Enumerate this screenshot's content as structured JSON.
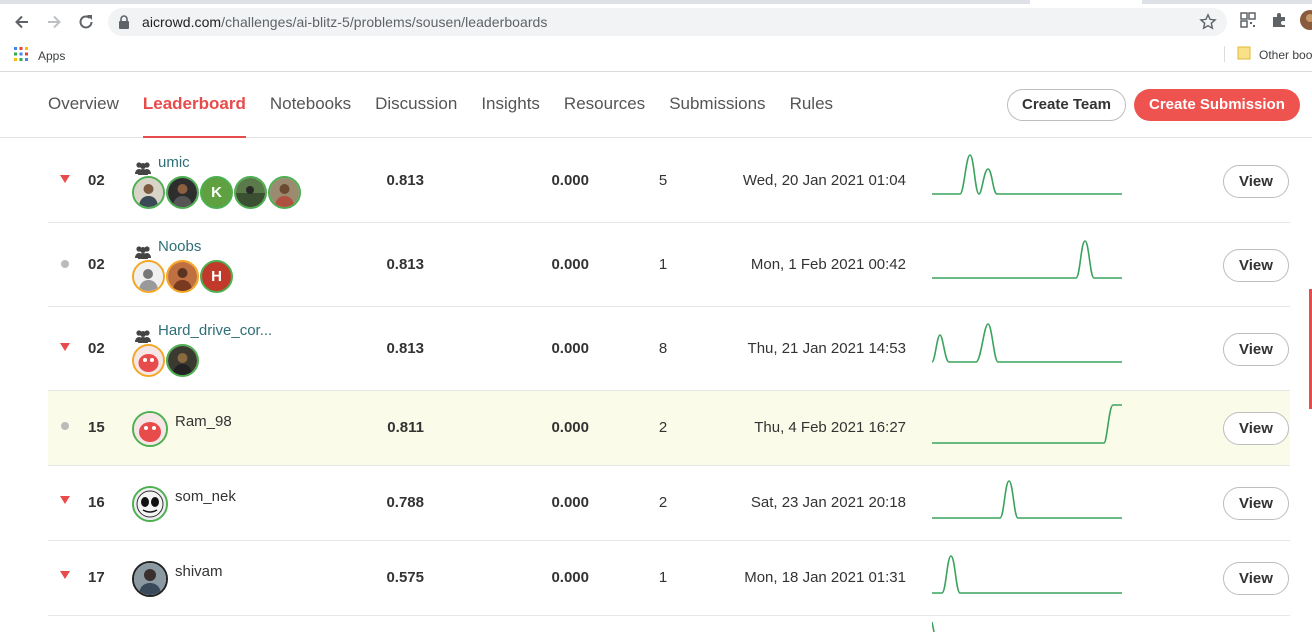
{
  "browser": {
    "url_domain": "aicrowd.com",
    "url_path": "/challenges/ai-blitz-5/problems/sousen/leaderboards",
    "bookmarks_apps": "Apps",
    "bookmarks_other": "Other boo"
  },
  "nav": {
    "tabs": [
      {
        "label": "Overview",
        "active": false
      },
      {
        "label": "Leaderboard",
        "active": true
      },
      {
        "label": "Notebooks",
        "active": false
      },
      {
        "label": "Discussion",
        "active": false
      },
      {
        "label": "Insights",
        "active": false
      },
      {
        "label": "Resources",
        "active": false
      },
      {
        "label": "Submissions",
        "active": false
      },
      {
        "label": "Rules",
        "active": false
      }
    ],
    "create_team": "Create Team",
    "create_submission": "Create Submission"
  },
  "colors": {
    "accent": "#e84b4b",
    "spark": "#3aa35d",
    "highlight_row": "#fbfbe9"
  },
  "rows": [
    {
      "trend": "down",
      "rank": "02",
      "is_team": true,
      "name": "umic",
      "score_primary": "0.813",
      "score_secondary": "0.000",
      "submissions": "5",
      "date": "Wed, 20 Jan 2021 01:04",
      "action": "View",
      "avatar_count": 5
    },
    {
      "trend": "same",
      "rank": "02",
      "is_team": true,
      "name": "Noobs",
      "score_primary": "0.813",
      "score_secondary": "0.000",
      "submissions": "1",
      "date": "Mon, 1 Feb 2021 00:42",
      "action": "View",
      "avatar_count": 3
    },
    {
      "trend": "down",
      "rank": "02",
      "is_team": true,
      "name": "Hard_drive_cor...",
      "score_primary": "0.813",
      "score_secondary": "0.000",
      "submissions": "8",
      "date": "Thu, 21 Jan 2021 14:53",
      "action": "View",
      "avatar_count": 2
    },
    {
      "trend": "same",
      "rank": "15",
      "is_team": false,
      "name": "Ram_98",
      "score_primary": "0.811",
      "score_secondary": "0.000",
      "submissions": "2",
      "date": "Thu, 4 Feb 2021 16:27",
      "action": "View",
      "highlight": true
    },
    {
      "trend": "down",
      "rank": "16",
      "is_team": false,
      "name": "som_nek",
      "score_primary": "0.788",
      "score_secondary": "0.000",
      "submissions": "2",
      "date": "Sat, 23 Jan 2021 20:18",
      "action": "View"
    },
    {
      "trend": "down",
      "rank": "17",
      "is_team": false,
      "name": "shivam",
      "score_primary": "0.575",
      "score_secondary": "0.000",
      "submissions": "1",
      "date": "Mon, 18 Jan 2021 01:31",
      "action": "View"
    }
  ],
  "avatar_letters": {
    "umic_3": "K",
    "noobs_3": "H"
  }
}
